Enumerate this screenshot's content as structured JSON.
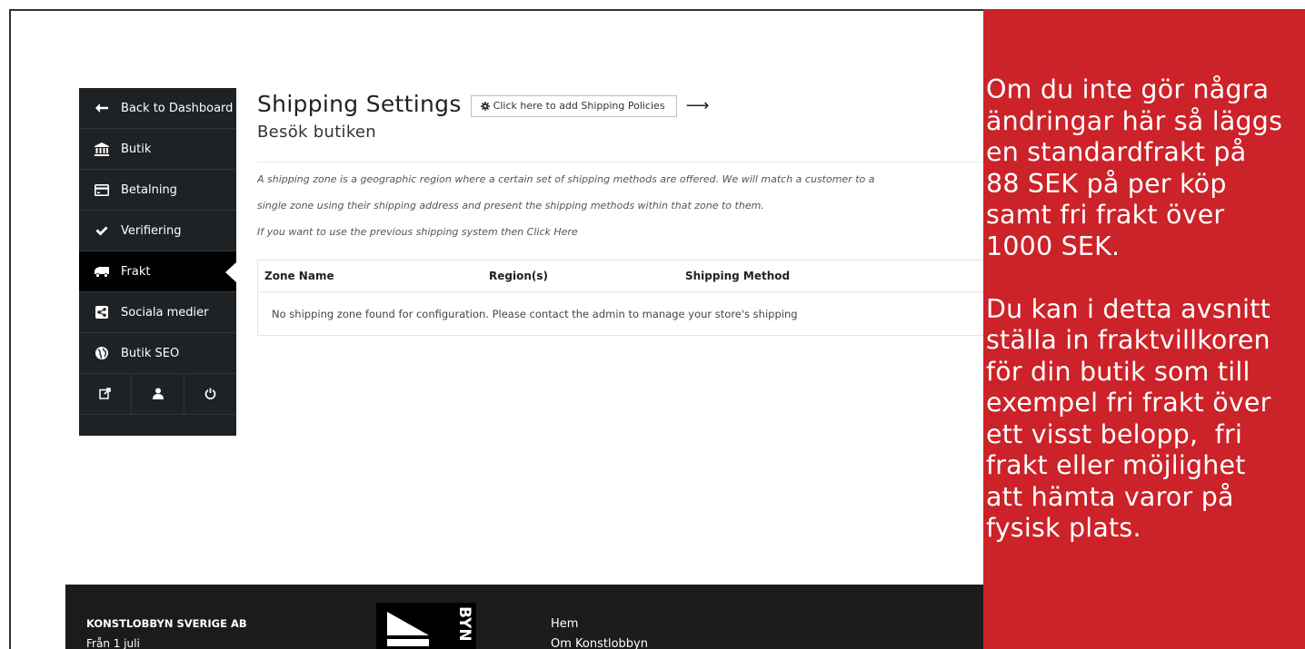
{
  "sidebar": {
    "items": [
      {
        "label": "Back to Dashboard",
        "icon": "arrow-left-icon"
      },
      {
        "label": "Butik",
        "icon": "bank-icon"
      },
      {
        "label": "Betalning",
        "icon": "credit-card-icon"
      },
      {
        "label": "Verifiering",
        "icon": "check-icon"
      },
      {
        "label": "Frakt",
        "icon": "truck-icon",
        "active": true
      },
      {
        "label": "Sociala medier",
        "icon": "share-icon"
      },
      {
        "label": "Butik SEO",
        "icon": "globe-icon"
      }
    ],
    "bottom_icons": [
      "external-link-icon",
      "user-icon",
      "power-icon"
    ]
  },
  "main": {
    "title": "Shipping Settings",
    "policy_button": "Click here to add Shipping Policies",
    "arrow": "⟶",
    "subtitle": "Besök butiken",
    "description_line1": "A shipping zone is a geographic region where a certain set of shipping methods are offered. We will match a customer to a",
    "description_line2": "single zone using their shipping address and present the shipping methods within that zone to them.",
    "previous_system": "If you want to use the previous shipping system then Click Here",
    "table": {
      "headers": [
        "Zone Name",
        "Region(s)",
        "Shipping Method"
      ],
      "empty_message": "No shipping zone found for configuration. Please contact the admin to manage your store's shipping"
    }
  },
  "footer": {
    "company": "KONSTLOBBYN SVERIGE AB",
    "line2": "Från 1 juli",
    "links": [
      "Hem",
      "Om Konstlobbyn"
    ],
    "logo_text": "BYN"
  },
  "overlay": {
    "lines": [
      "Om du inte gör några",
      "ändringar här så läggs",
      "en standardfrakt på",
      "88 SEK på per köp",
      "samt fri frakt över",
      "1000 SEK.",
      "",
      "Du kan i detta avsnitt",
      "ställa in fraktvillkoren",
      "för din butik som till",
      "exempel fri frakt över",
      "ett visst belopp,  fri",
      "frakt eller möjlighet",
      "att hämta varor på",
      "fysisk plats."
    ]
  },
  "colors": {
    "sidebar_bg": "#1f2224",
    "overlay_red": "#cc2229",
    "footer_bg": "#1b1b1b"
  }
}
